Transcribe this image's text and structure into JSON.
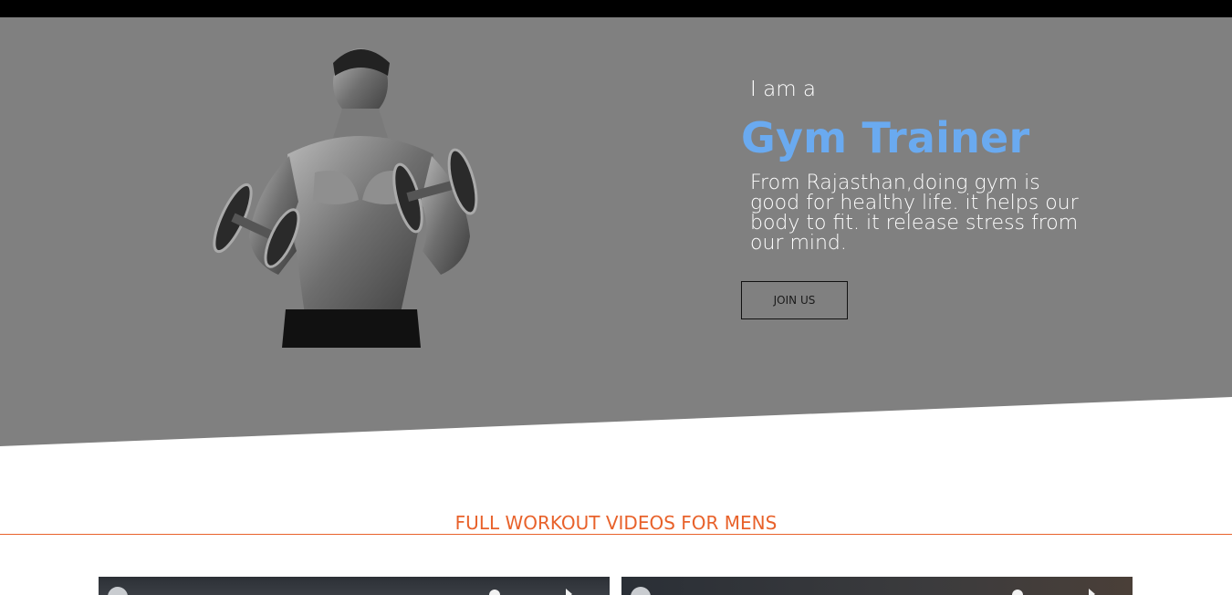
{
  "hero": {
    "intro": "I am a",
    "title": "Gym Trainer",
    "description": "From Rajasthan,doing gym is good for healthy life. it helps our body to fit. it release stress from our mind.",
    "cta_label": "JOIN US",
    "title_color": "#6aaaf0",
    "background_color": "#808080"
  },
  "section": {
    "heading": "FULL WORKOUT VIDEOS FOR MENS",
    "accent_color": "#e8622b"
  },
  "videos": [
    {
      "icons": [
        "channel-avatar-icon",
        "more-options-icon",
        "share-icon"
      ]
    },
    {
      "icons": [
        "channel-avatar-icon",
        "more-options-icon",
        "share-icon"
      ]
    }
  ]
}
